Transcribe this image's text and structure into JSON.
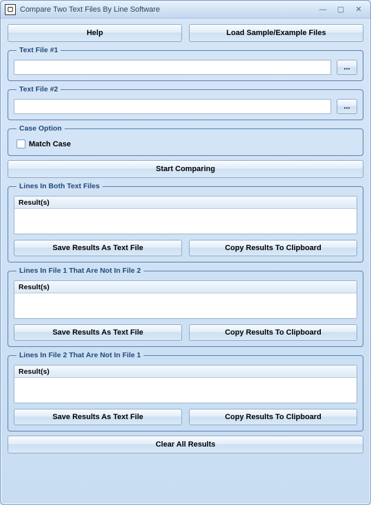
{
  "window": {
    "title": "Compare Two Text Files By Line Software"
  },
  "buttons": {
    "help": "Help",
    "load_sample": "Load Sample/Example Files",
    "browse": "...",
    "start": "Start Comparing",
    "save_text": "Save Results As Text File",
    "copy_clip": "Copy Results To Clipboard",
    "clear_all": "Clear All Results"
  },
  "groups": {
    "file1": "Text File #1",
    "file2": "Text File #2",
    "case_option": "Case Option",
    "match_case": "Match Case",
    "both": "Lines In Both Text Files",
    "only1": "Lines In File 1 That Are Not In File 2",
    "only2": "Lines In File 2 That Are Not In File 1",
    "results_header": "Result(s)"
  },
  "inputs": {
    "file1_value": "",
    "file2_value": ""
  }
}
